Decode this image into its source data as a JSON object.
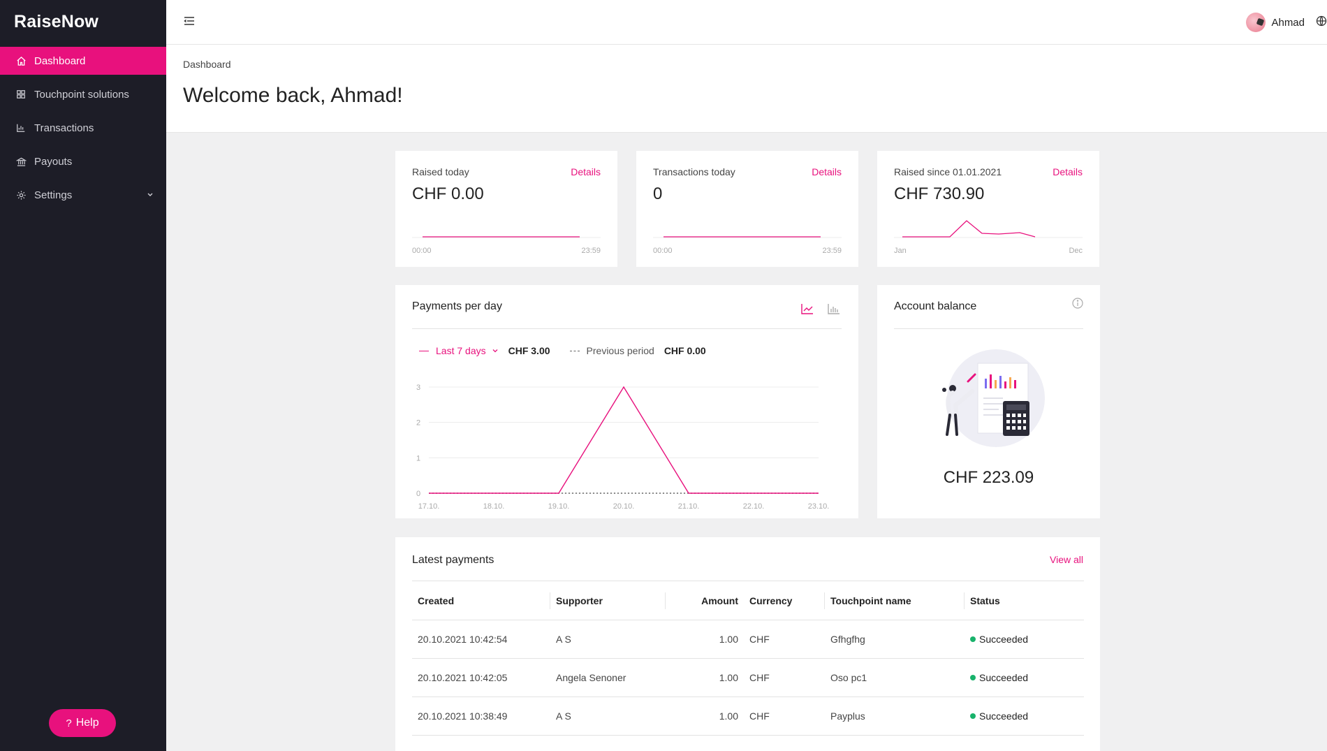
{
  "app": {
    "logo": "RaiseNow"
  },
  "sidebar": {
    "items": [
      {
        "label": "Dashboard",
        "icon": "home-icon",
        "active": true
      },
      {
        "label": "Touchpoint solutions",
        "icon": "grid-icon"
      },
      {
        "label": "Transactions",
        "icon": "bar-chart-icon"
      },
      {
        "label": "Payouts",
        "icon": "bank-icon"
      },
      {
        "label": "Settings",
        "icon": "gear-icon",
        "expandable": true
      }
    ],
    "help_label": "Help"
  },
  "topbar": {
    "user_name": "Ahmad"
  },
  "header": {
    "breadcrumb": "Dashboard",
    "welcome": "Welcome back, Ahmad!"
  },
  "stats": [
    {
      "label": "Raised today",
      "details": "Details",
      "value": "CHF 0.00",
      "axis_start": "00:00",
      "axis_end": "23:59"
    },
    {
      "label": "Transactions today",
      "details": "Details",
      "value": "0",
      "axis_start": "00:00",
      "axis_end": "23:59"
    },
    {
      "label": "Raised since 01.01.2021",
      "details": "Details",
      "value": "CHF 730.90",
      "axis_start": "Jan",
      "axis_end": "Dec"
    }
  ],
  "payments_chart": {
    "title": "Payments per day",
    "period_label": "Last 7 days",
    "period_value": "CHF 3.00",
    "previous_label": "Previous period",
    "previous_value": "CHF 0.00"
  },
  "chart_data": {
    "type": "line",
    "x": [
      "17.10.",
      "18.10.",
      "19.10.",
      "20.10.",
      "21.10.",
      "22.10.",
      "23.10."
    ],
    "y_ticks": [
      "0",
      "1",
      "2",
      "3"
    ],
    "ylim": [
      0,
      3
    ],
    "series": [
      {
        "name": "Last 7 days",
        "values": [
          0,
          0,
          0,
          3,
          0,
          0,
          0
        ],
        "color": "#e8117d",
        "style": "solid"
      },
      {
        "name": "Previous period",
        "values": [
          0,
          0,
          0,
          0,
          0,
          0,
          0
        ],
        "color": "#666666",
        "style": "dotted"
      }
    ],
    "grid": true
  },
  "balance": {
    "title": "Account balance",
    "value": "CHF 223.09"
  },
  "latest": {
    "title": "Latest payments",
    "view_all": "View all",
    "columns": [
      "Created",
      "Supporter",
      "Amount",
      "Currency",
      "Touchpoint name",
      "Status"
    ],
    "rows": [
      [
        "20.10.2021 10:42:54",
        "A S",
        "1.00",
        "CHF",
        "Gfhgfhg",
        "Succeeded"
      ],
      [
        "20.10.2021 10:42:05",
        "Angela Senoner",
        "1.00",
        "CHF",
        "Oso pc1",
        "Succeeded"
      ],
      [
        "20.10.2021 10:38:49",
        "A S",
        "1.00",
        "CHF",
        "Payplus",
        "Succeeded"
      ]
    ]
  },
  "colors": {
    "accent": "#e8117d",
    "sidebar": "#1d1d27",
    "success": "#18b26b"
  }
}
